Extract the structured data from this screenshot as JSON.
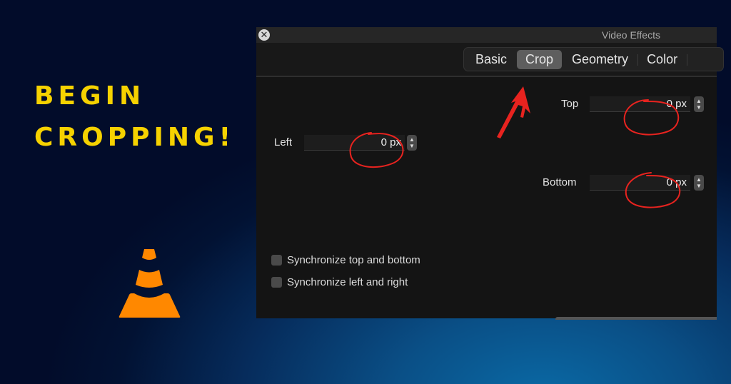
{
  "promo": {
    "headline_line1": "BEGIN",
    "headline_line2": "CROPPING!",
    "logo_icon": "vlc-cone-icon",
    "accent_color": "#f6d200",
    "logo_color": "#ff8800"
  },
  "window": {
    "title": "Video Effects",
    "close_icon": "close-icon",
    "tabs": [
      {
        "label": "Basic",
        "active": false
      },
      {
        "label": "Crop",
        "active": true
      },
      {
        "label": "Geometry",
        "active": false
      },
      {
        "label": "Color",
        "active": false
      }
    ]
  },
  "crop": {
    "top": {
      "label": "Top",
      "value": "0 px"
    },
    "left": {
      "label": "Left",
      "value": "0 px"
    },
    "bottom": {
      "label": "Bottom",
      "value": "0 px"
    },
    "sync_top_bottom": {
      "label": "Synchronize top and bottom",
      "checked": false
    },
    "sync_left_right": {
      "label": "Synchronize left and right",
      "checked": false
    }
  },
  "annotations": {
    "color": "#e8231f",
    "items": [
      "arrow pointing to Crop tab",
      "circle around Top value",
      "circle around Left value",
      "circle around Bottom value"
    ]
  }
}
